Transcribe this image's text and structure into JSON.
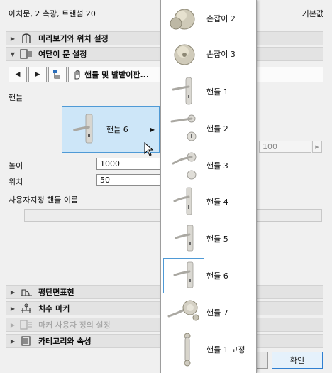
{
  "window": {
    "title": "아치문, 2 측광, 트랜섬 20",
    "preset": "기본값"
  },
  "sections": {
    "preview": "미리보기와 위치 설정",
    "opening": "여닫이 문 설정",
    "plan": "평단면표현",
    "dimension": "치수 마커",
    "marker_custom": "마커 사용자 정의 설정",
    "category": "카테고리와 속성"
  },
  "tabs": {
    "current": "핸들 및 발받이판..."
  },
  "handle": {
    "section_label": "핸들",
    "selected_name": "핸들 6",
    "height_label": "높이",
    "height_value": "1000",
    "position_label": "위치",
    "position_value": "50",
    "custom_name_label": "사용자지정 핸들 이름",
    "custom_name_value": "",
    "side_value": "100"
  },
  "buttons": {
    "ok": "확인"
  },
  "popup": {
    "items": [
      {
        "name": "손잡이 2",
        "icon": "round-knob-icon"
      },
      {
        "name": "손잡이 3",
        "icon": "round-knob-icon"
      },
      {
        "name": "핸들 1",
        "icon": "lever-plate-icon"
      },
      {
        "name": "핸들 2",
        "icon": "lever-rosette-icon"
      },
      {
        "name": "핸들 3",
        "icon": "lever-rosette-icon"
      },
      {
        "name": "핸들 4",
        "icon": "lever-plate-icon"
      },
      {
        "name": "핸들 5",
        "icon": "lever-plate-icon"
      },
      {
        "name": "핸들 6",
        "icon": "lever-plate-icon"
      },
      {
        "name": "핸들 7",
        "icon": "lever-knob-icon"
      },
      {
        "name": "핸들 1 고정",
        "icon": "pull-handle-icon"
      }
    ],
    "selected_index": 7
  }
}
